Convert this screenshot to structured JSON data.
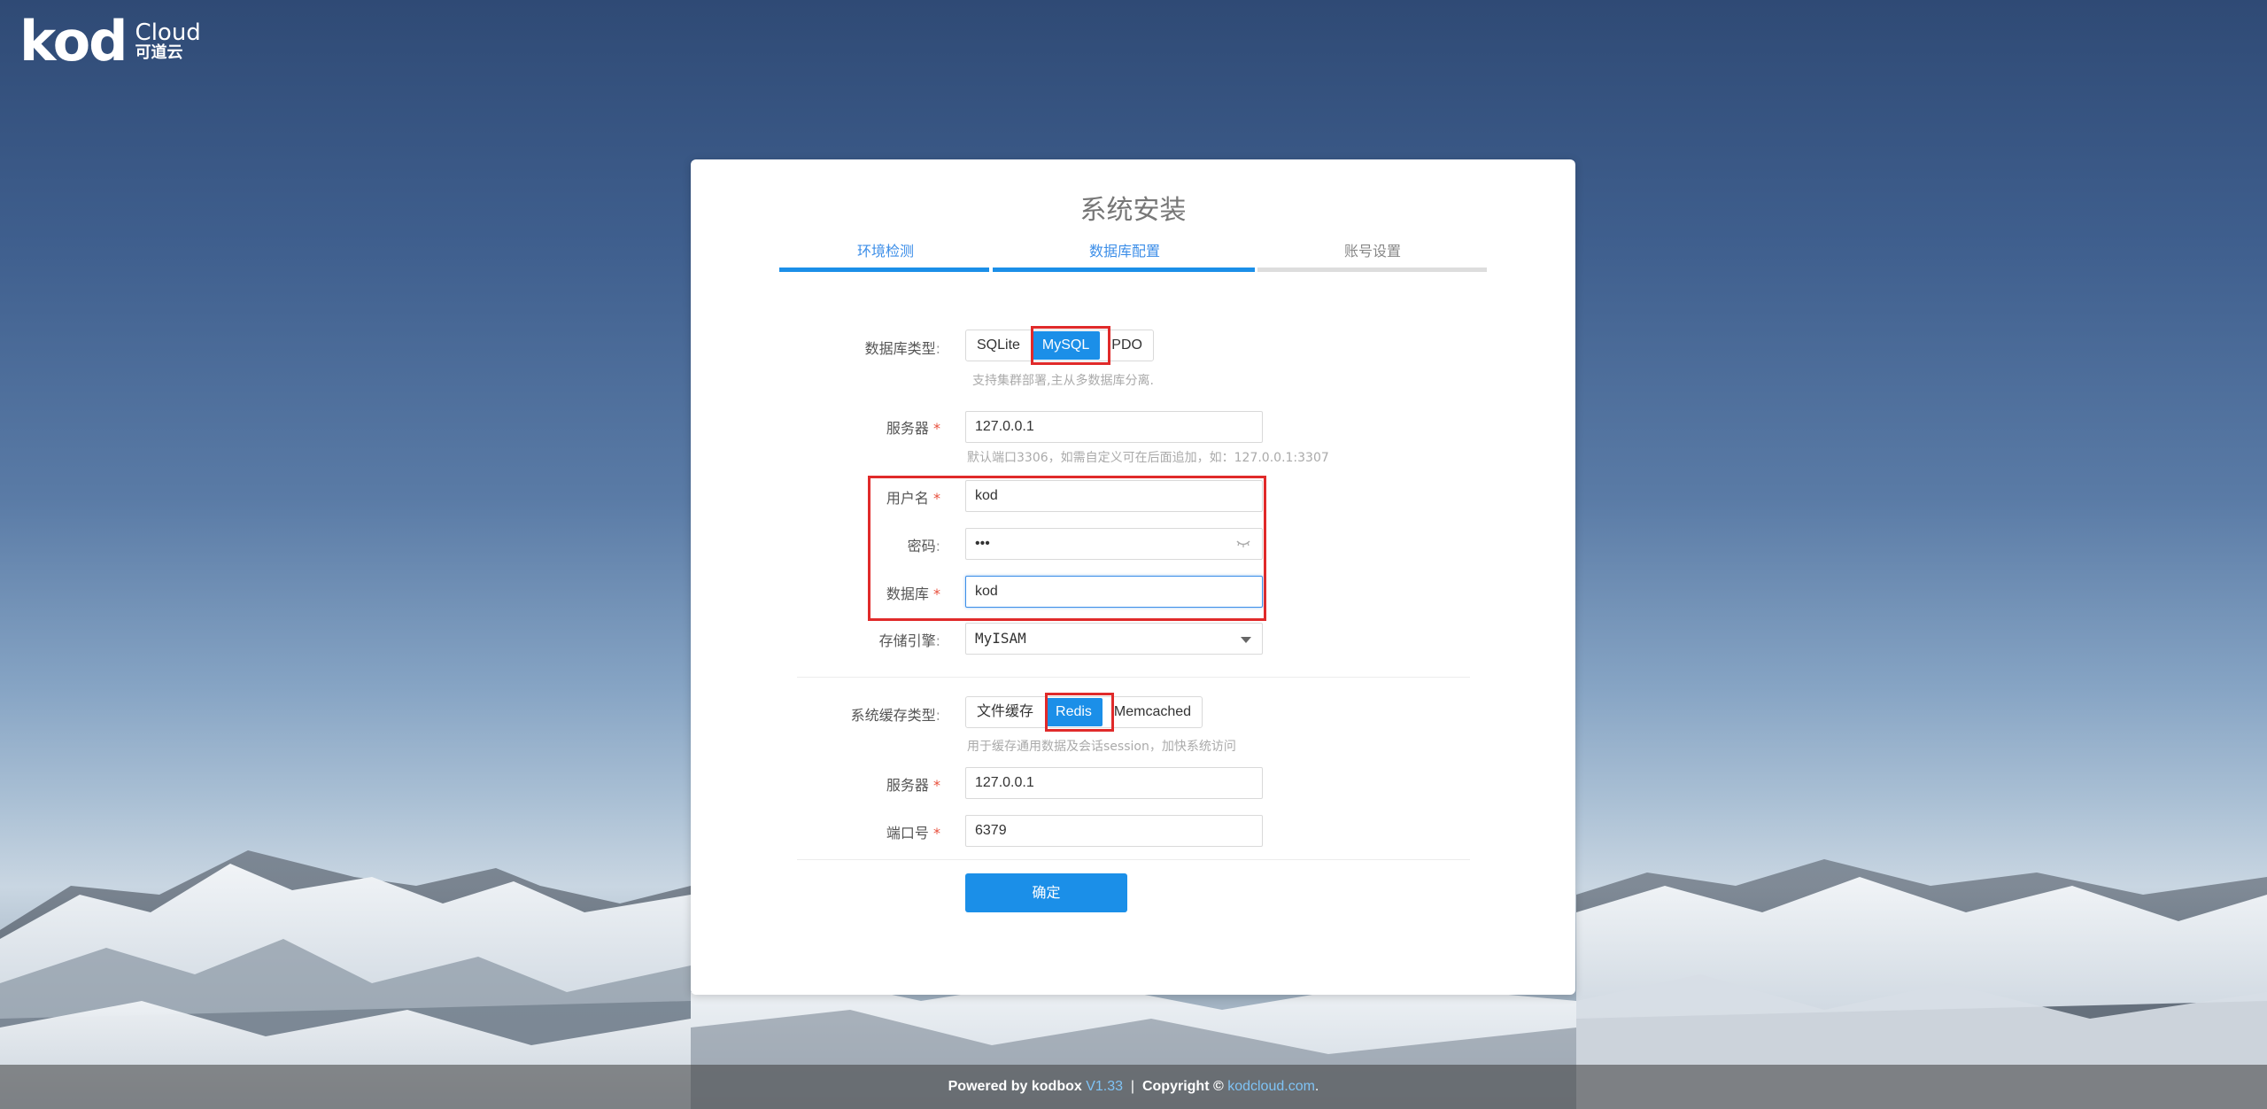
{
  "brand": {
    "mark": "kod",
    "cloud": "Cloud",
    "cn": "可道云"
  },
  "page_title": "系统安装",
  "steps": [
    {
      "label": "环境检测",
      "state": "done"
    },
    {
      "label": "数据库配置",
      "state": "active"
    },
    {
      "label": "账号设置",
      "state": "pending"
    }
  ],
  "db": {
    "type_label": "数据库类型",
    "types": [
      "SQLite",
      "MySQL",
      "PDO"
    ],
    "selected_type": "MySQL",
    "type_hint": "支持集群部署,主从多数据库分离.",
    "server_label": "服务器",
    "server_value": "127.0.0.1",
    "server_hint": "默认端口3306，如需自定义可在后面追加，如：127.0.0.1:3307",
    "user_label": "用户名",
    "user_value": "kod",
    "password_label": "密码",
    "password_value": "•••",
    "name_label": "数据库",
    "name_value": "kod",
    "engine_label": "存储引擎",
    "engine_value": "MyISAM"
  },
  "cache": {
    "type_label": "系统缓存类型",
    "types": [
      "文件缓存",
      "Redis",
      "Memcached"
    ],
    "selected_type": "Redis",
    "type_hint": "用于缓存通用数据及会话session，加快系统访问",
    "server_label": "服务器",
    "server_value": "127.0.0.1",
    "port_label": "端口号",
    "port_value": "6379"
  },
  "confirm_label": "确定",
  "footer": {
    "powered": "Powered by kodbox",
    "version": "V1.33",
    "sep": "|",
    "copyright": "Copyright ©",
    "site": "kodcloud.com",
    "end": "."
  },
  "colors": {
    "accent": "#1b8fe8",
    "required": "#e84f3c",
    "highlight": "#e02a2a"
  }
}
